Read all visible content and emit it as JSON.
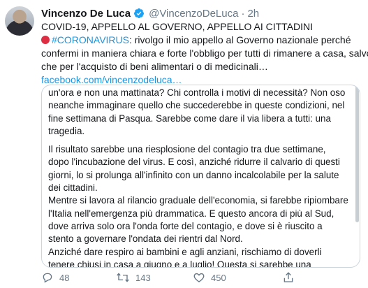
{
  "tweet": {
    "author_name": "Vincenzo De Luca",
    "handle": "@VincenzoDeLuca",
    "separator": "·",
    "time": "2h",
    "title": "COVID-19, APPELLO AL GOVERNO, APPELLO AI CITTADINI",
    "hashtag": "#CORONAVIRUS",
    "line2_rest": ": rivolgo il mio appello al Governo nazionale perché",
    "line3": "confermi in maniera chiara e forte l'obbligo per tutti di rimanere a casa, salvo",
    "line4": "che per l'acquisto di beni alimentari o di medicinali…",
    "link": "facebook.com/vincenzodeluca…"
  },
  "card": {
    "lines": [
      "un'ora e non una mattinata? Chi controlla i motivi di necessità? Non oso",
      "neanche immaginare quello che succederebbe in queste condizioni, nel",
      "fine settimana di Pasqua. Sarebbe come dare il via libera a tutti: una",
      "tragedia.",
      "",
      "Il risultato sarebbe una riesplosione del contagio tra due settimane,",
      "dopo l'incubazione del virus. E così, anziché ridurre il calvario di questi",
      "giorni, lo si prolunga all'infinito con un danno incalcolabile per la salute",
      "dei cittadini.",
      "Mentre si lavora al rilancio graduale dell'economia, si farebbe ripiombare",
      "l'Italia nell'emergenza più drammatica. E questo ancora di più al Sud,",
      "dove arriva solo ora l'onda forte del contagio, e dove si è riuscito a",
      "stento a governare l'ondata dei rientri dal Nord.",
      "Anziché dare respiro ai bambini e agli anziani, rischiamo di doverli",
      "tenere chiusi in casa a giugno e a luglio! Questa si sarebbe una"
    ]
  },
  "actions": {
    "replies": "48",
    "retweets": "143",
    "likes": "450"
  },
  "colors": {
    "link": "#1b95e0",
    "muted": "#657786",
    "border": "#ccd6dd",
    "red_circle": "#dd2e44"
  }
}
